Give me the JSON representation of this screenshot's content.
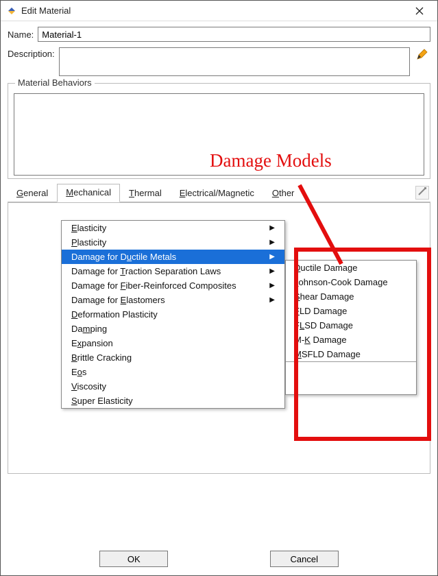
{
  "window": {
    "title": "Edit Material"
  },
  "fields": {
    "name_label": "Name:",
    "name_value": "Material-1",
    "description_label": "Description:",
    "description_value": ""
  },
  "behaviors": {
    "legend": "Material Behaviors"
  },
  "tabs": {
    "general": "General",
    "mechanical": "Mechanical",
    "thermal": "Thermal",
    "electrical": "Electrical/Magnetic",
    "other": "Other"
  },
  "menu": {
    "elasticity": "Elasticity",
    "plasticity": "Plasticity",
    "damage_ductile": "Damage for Ductile Metals",
    "damage_traction": "Damage for Traction Separation Laws",
    "damage_fiber": "Damage for Fiber-Reinforced Composites",
    "damage_elastomers": "Damage for Elastomers",
    "deformation_plasticity": "Deformation Plasticity",
    "damping": "Damping",
    "expansion": "Expansion",
    "brittle_cracking": "Brittle Cracking",
    "eos": "Eos",
    "viscosity": "Viscosity",
    "super_elasticity": "Super Elasticity"
  },
  "submenu": {
    "ductile": "Ductile Damage",
    "johnson_cook": "Johnson-Cook Damage",
    "shear": "Shear Damage",
    "fld": "FLD Damage",
    "flsd": "FLSD Damage",
    "mk": "M-K Damage",
    "msfld": "MSFLD Damage"
  },
  "buttons": {
    "ok": "OK",
    "cancel": "Cancel"
  },
  "annotation": {
    "label": "Damage Models"
  },
  "mnemonic_letters": {
    "general": "G",
    "mechanical": "M",
    "thermal": "T",
    "electrical": "E",
    "other": "O",
    "elasticity": "E",
    "plasticity": "P",
    "damage_ductile": "u",
    "damage_traction": "T",
    "damage_fiber": "F",
    "damage_elastomers": "E",
    "deformation_plasticity": "D",
    "damping": "m",
    "expansion": "x",
    "brittle_cracking": "B",
    "eos": "o",
    "viscosity": "V",
    "super_elasticity": "S",
    "sub_ductile": "D",
    "sub_johnson": "J",
    "sub_shear": "S",
    "sub_fld": "F",
    "sub_flsd": "L",
    "sub_mk": "K",
    "sub_msfld": "M"
  }
}
